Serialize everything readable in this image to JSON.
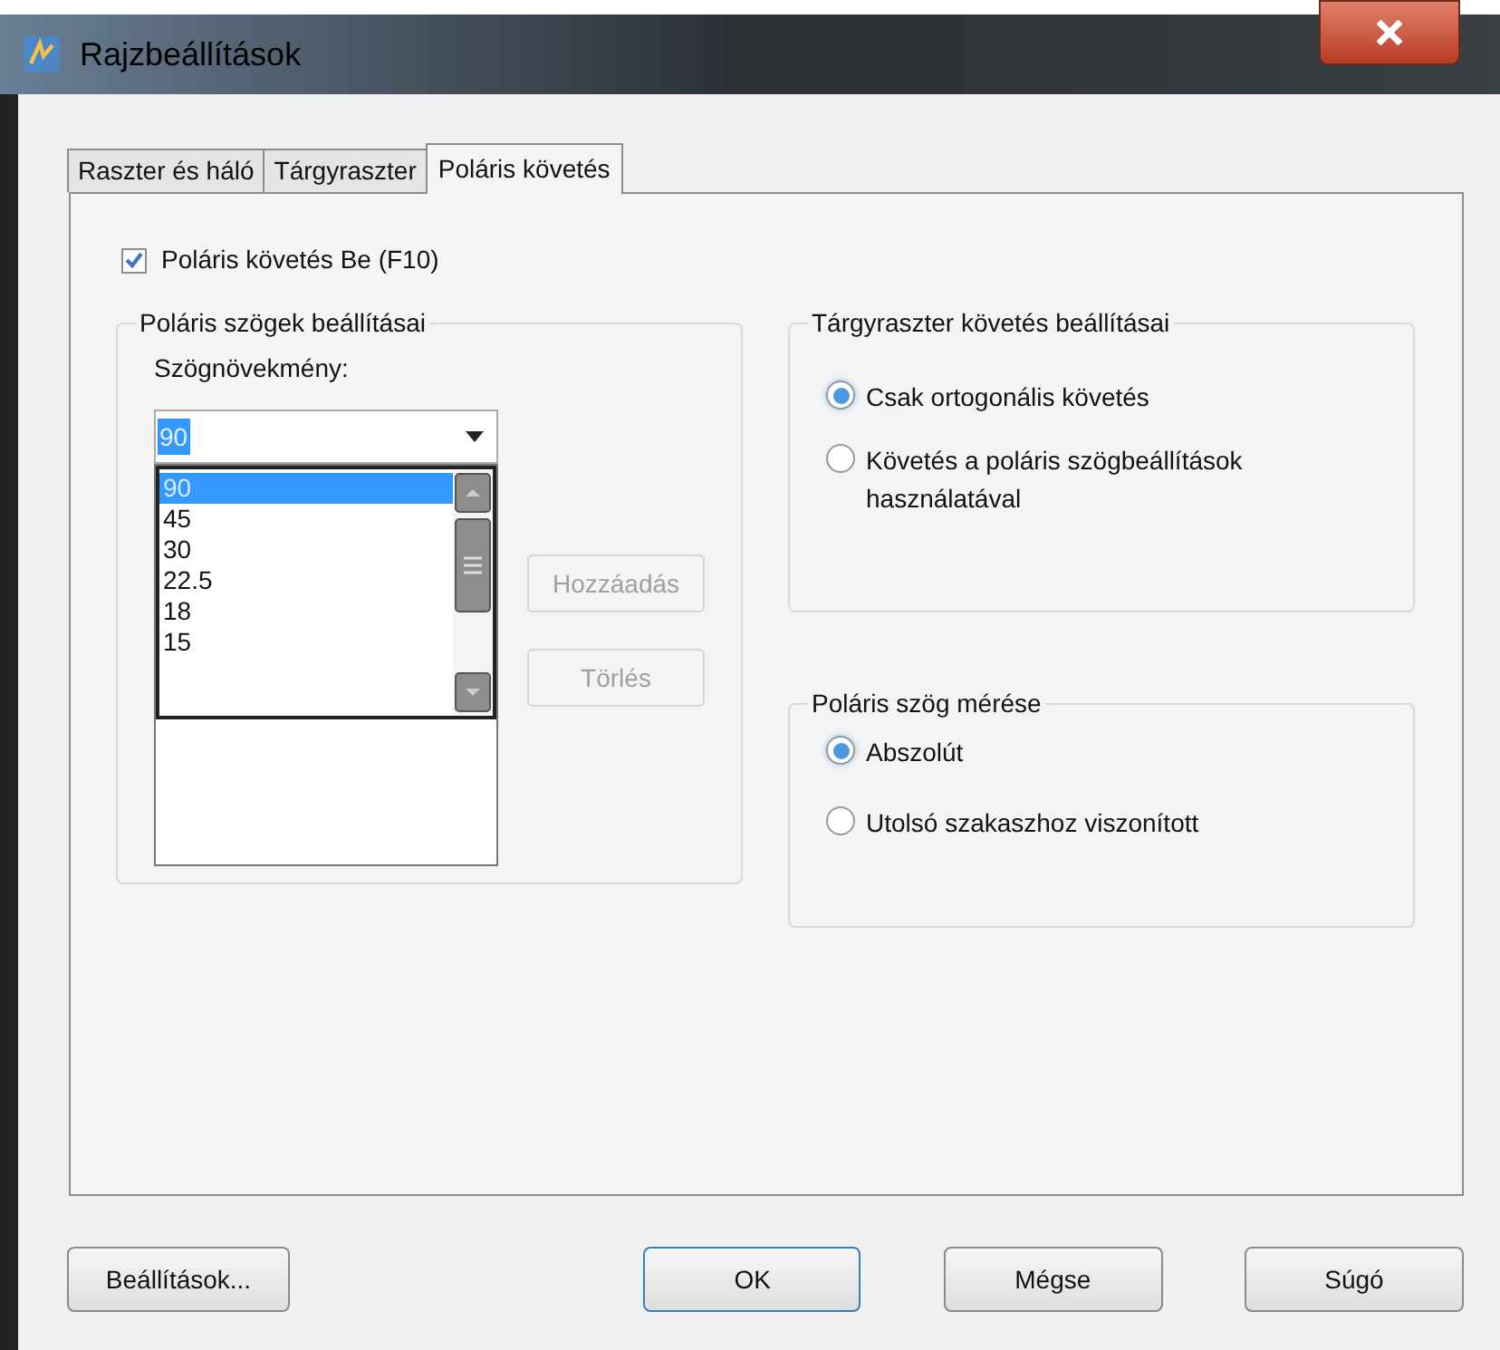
{
  "window": {
    "title": "Rajzbeállítások"
  },
  "tabs": [
    {
      "label": "Raszter és háló",
      "selected": false
    },
    {
      "label": "Tárgyraszter",
      "selected": false
    },
    {
      "label": "Poláris követés",
      "selected": true
    }
  ],
  "polar_on": {
    "label": "Poláris követés Be (F10)",
    "checked": true
  },
  "angle_settings": {
    "title": "Poláris szögek beállításai",
    "label": "Szögnövekmény:",
    "value": "90",
    "options": [
      {
        "label": "90",
        "selected": true
      },
      {
        "label": "45",
        "selected": false
      },
      {
        "label": "30",
        "selected": false
      },
      {
        "label": "22.5",
        "selected": false
      },
      {
        "label": "18",
        "selected": false
      },
      {
        "label": "15",
        "selected": false
      }
    ],
    "buttons": [
      {
        "label": "Hozzáadás",
        "disabled": true
      },
      {
        "label": "Törlés",
        "disabled": true
      }
    ]
  },
  "tracking_settings": {
    "title": "Tárgyraszter követés beállításai",
    "options": [
      {
        "label": "Csak ortogonális követés",
        "selected": true
      },
      {
        "label": "Követés a poláris szögbeállítások használatával",
        "selected": false
      }
    ]
  },
  "angle_measure": {
    "title": "Poláris szög mérése",
    "options": [
      {
        "label": "Abszolút",
        "selected": true
      },
      {
        "label": "Utolsó szakaszhoz viszonított",
        "selected": false
      }
    ]
  },
  "footer_buttons": [
    {
      "label": "Beállítások...",
      "default": false
    },
    {
      "label": "OK",
      "default": true
    },
    {
      "label": "Mégse",
      "default": false
    },
    {
      "label": "Súgó",
      "default": false
    }
  ]
}
